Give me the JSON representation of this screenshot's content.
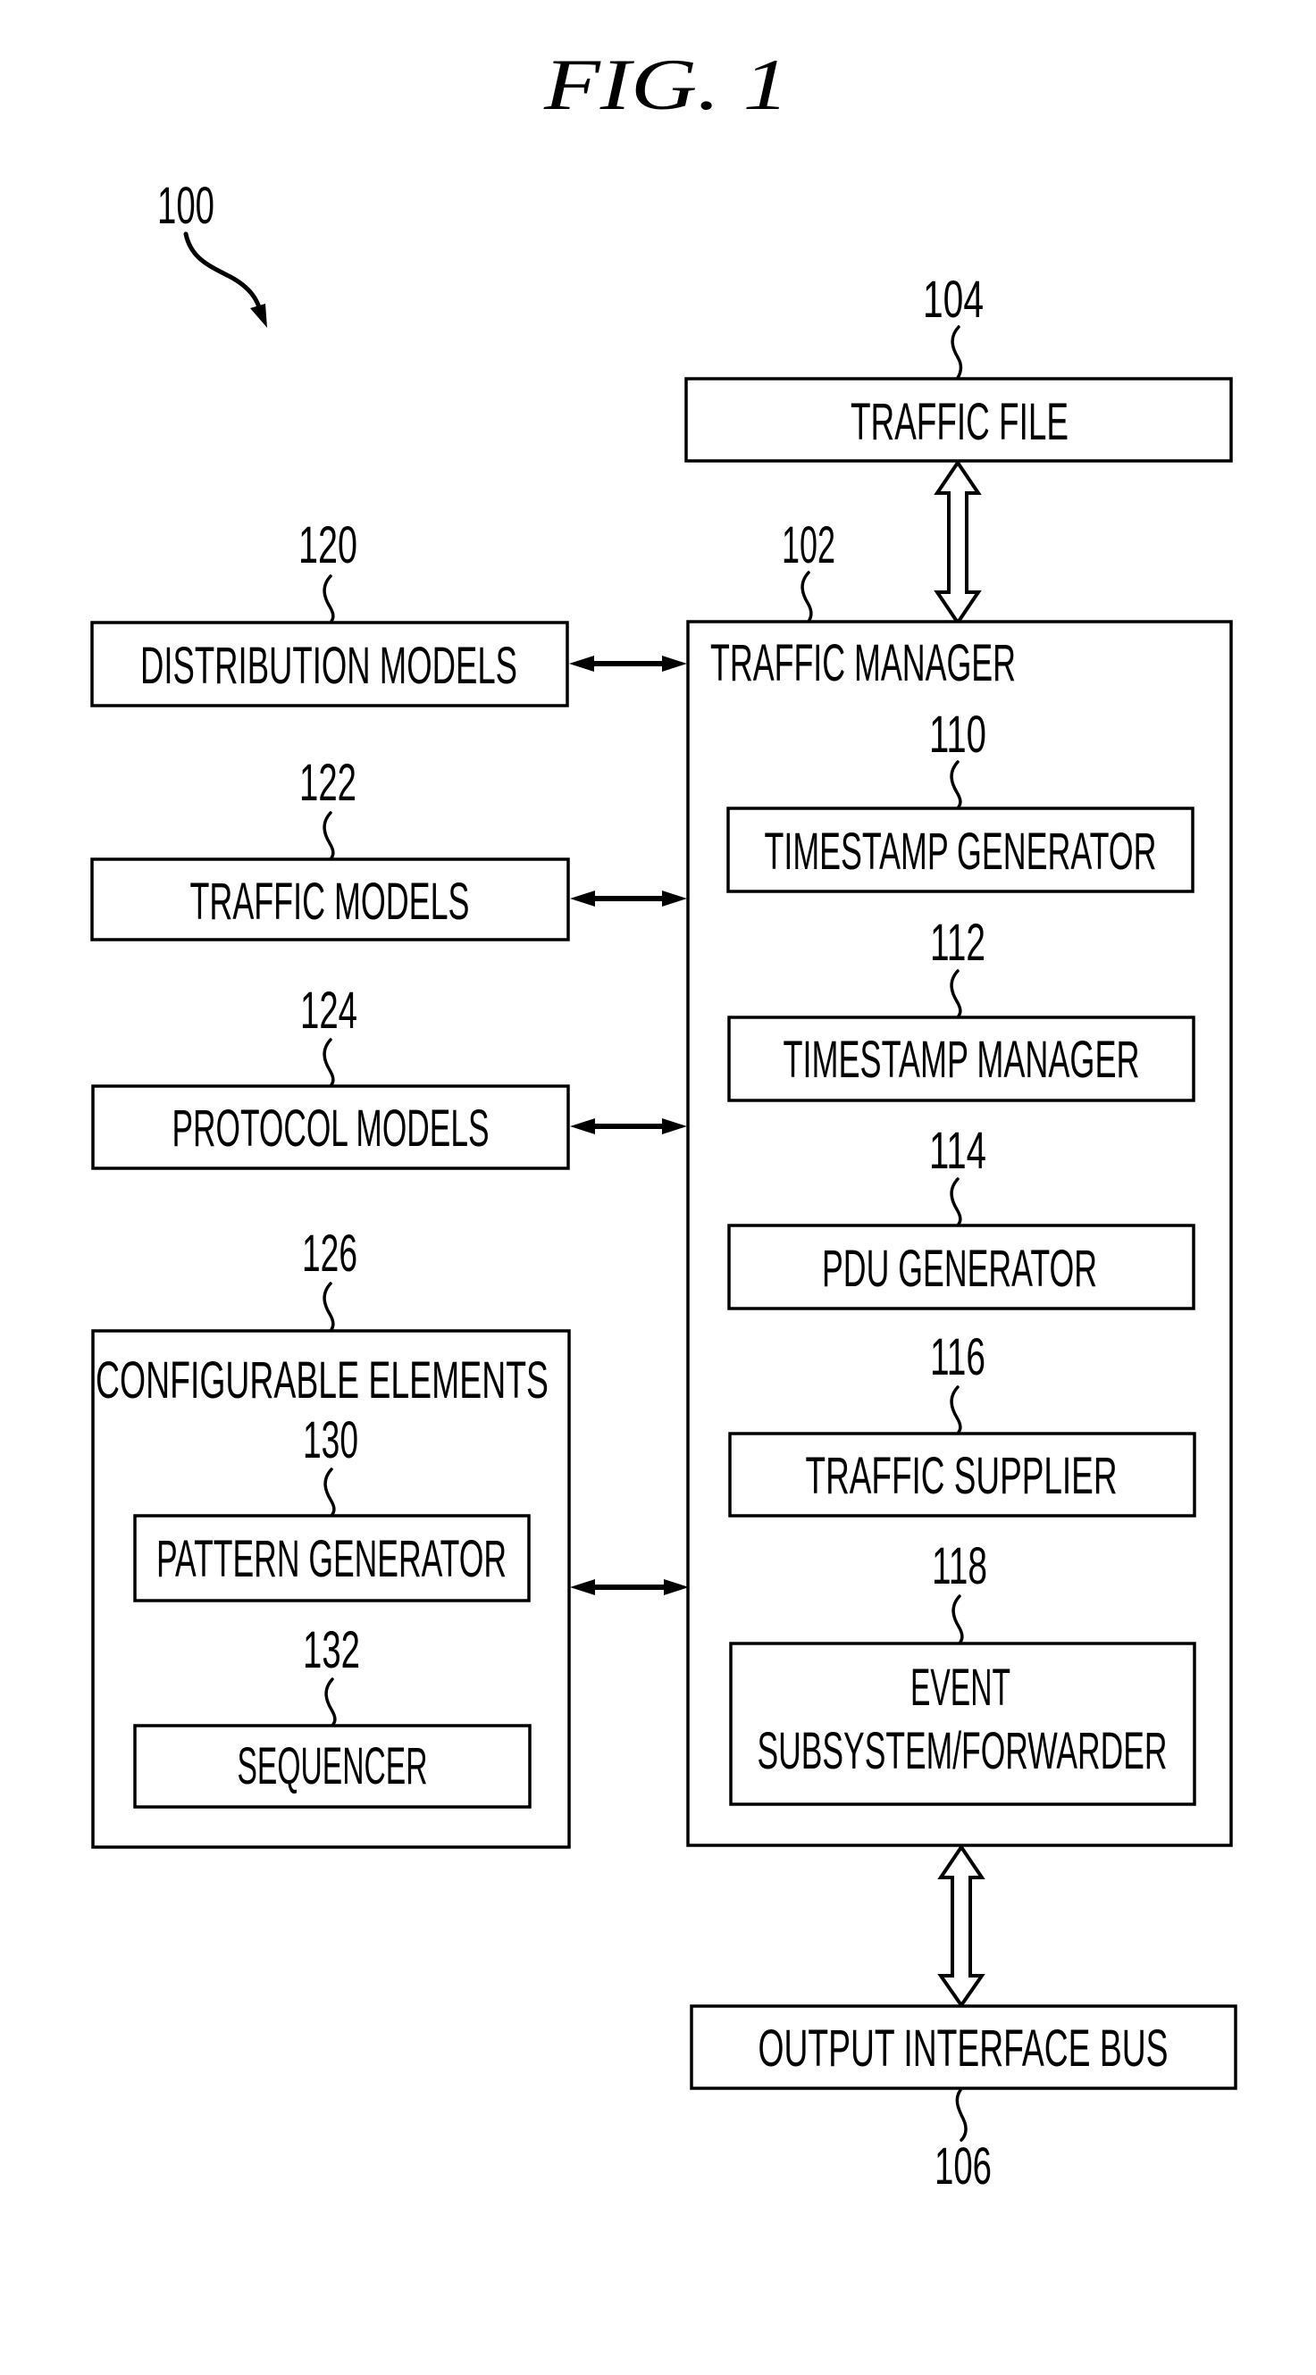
{
  "figure": {
    "title": "FIG. 1",
    "system_ref": "100"
  },
  "colors": {
    "ink": "#000000",
    "paper": "#ffffff"
  },
  "blocks": {
    "traffic_file": {
      "ref": "104",
      "label": "TRAFFIC FILE"
    },
    "traffic_manager": {
      "ref": "102",
      "label": "TRAFFIC MANAGER",
      "children": {
        "timestamp_generator": {
          "ref": "110",
          "label": "TIMESTAMP GENERATOR"
        },
        "timestamp_manager": {
          "ref": "112",
          "label": "TIMESTAMP MANAGER"
        },
        "pdu_generator": {
          "ref": "114",
          "label": "PDU GENERATOR"
        },
        "traffic_supplier": {
          "ref": "116",
          "label": "TRAFFIC SUPPLIER"
        },
        "event_forwarder": {
          "ref": "118",
          "label_line1": "EVENT",
          "label_line2": "SUBSYSTEM/FORWARDER"
        }
      }
    },
    "distribution_models": {
      "ref": "120",
      "label": "DISTRIBUTION MODELS"
    },
    "traffic_models": {
      "ref": "122",
      "label": "TRAFFIC MODELS"
    },
    "protocol_models": {
      "ref": "124",
      "label": "PROTOCOL MODELS"
    },
    "configurable_elements": {
      "ref": "126",
      "label": "CONFIGURABLE ELEMENTS",
      "children": {
        "pattern_generator": {
          "ref": "130",
          "label": "PATTERN GENERATOR"
        },
        "sequencer": {
          "ref": "132",
          "label": "SEQUENCER"
        }
      }
    },
    "output_interface_bus": {
      "ref": "106",
      "label": "OUTPUT INTERFACE BUS"
    }
  },
  "connections": [
    {
      "from": "traffic_file",
      "to": "traffic_manager",
      "type": "hollow-bidirectional"
    },
    {
      "from": "distribution_models",
      "to": "traffic_manager",
      "type": "bidirectional"
    },
    {
      "from": "traffic_models",
      "to": "traffic_manager",
      "type": "bidirectional"
    },
    {
      "from": "protocol_models",
      "to": "traffic_manager",
      "type": "bidirectional"
    },
    {
      "from": "configurable_elements",
      "to": "traffic_manager",
      "type": "bidirectional"
    },
    {
      "from": "traffic_manager",
      "to": "output_interface_bus",
      "type": "hollow-bidirectional"
    }
  ]
}
